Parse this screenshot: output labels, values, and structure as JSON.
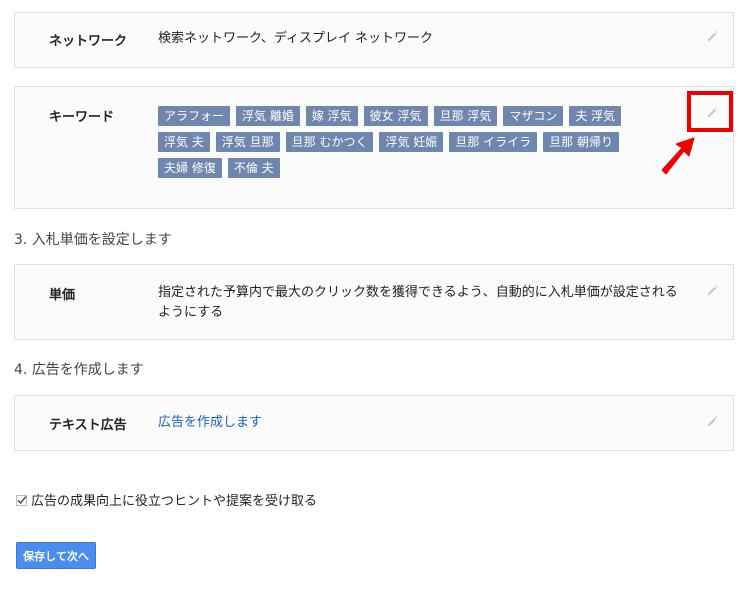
{
  "network": {
    "label": "ネットワーク",
    "value": "検索ネットワーク、ディスプレイ ネットワーク"
  },
  "keyword": {
    "label": "キーワード",
    "tags": [
      "アラフォー",
      "浮気 離婚",
      "嫁 浮気",
      "彼女 浮気",
      "旦那 浮気",
      "マザコン",
      "夫 浮気",
      "浮気 夫",
      "浮気 旦那",
      "旦那 むかつく",
      "浮気 妊娠",
      "旦那 イライラ",
      "旦那 朝帰り",
      "夫婦 修復",
      "不倫 夫"
    ]
  },
  "bid_section": {
    "title": "3. 入札単価を設定します"
  },
  "bid": {
    "label": "単価",
    "value": "指定された予算内で最大のクリック数を獲得できるよう、自動的に入札単価が設定されるようにする"
  },
  "ad_section": {
    "title": "4. 広告を作成します"
  },
  "text_ad": {
    "label": "テキスト広告",
    "link": "広告を作成します"
  },
  "hints": {
    "label": "広告の成果向上に役立つヒントや提案を受け取る",
    "checked": true
  },
  "actions": {
    "save_label": "保存して次へ"
  },
  "colors": {
    "tag_bg": "#6f86ae",
    "link": "#1a5fc8",
    "primary_button": "#4a8df0",
    "highlight": "#ee0000"
  },
  "icons": {
    "edit": "pencil-icon",
    "checkbox": "checkmark-icon",
    "annotation": "red-arrow"
  }
}
